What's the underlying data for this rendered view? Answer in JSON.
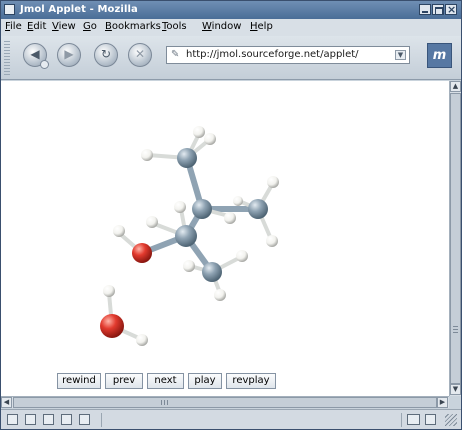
{
  "window": {
    "title": "Jmol Applet - Mozilla"
  },
  "menubar": {
    "items": [
      "File",
      "Edit",
      "View",
      "Go",
      "Bookmarks",
      "Tools",
      "Window",
      "Help"
    ],
    "mnemonics": [
      "F",
      "E",
      "V",
      "G",
      "B",
      "T",
      "W",
      "H"
    ]
  },
  "navigation": {
    "back_icon": "back-arrow-icon",
    "forward_icon": "forward-arrow-icon",
    "reload_icon": "reload-icon",
    "stop_icon": "stop-icon",
    "url": "http://jmol.sourceforge.net/applet/",
    "page_icon": "page-icon",
    "throbber_icon": "mozilla-logo-icon"
  },
  "applet": {
    "buttons": [
      "rewind",
      "prev",
      "next",
      "play",
      "revplay"
    ],
    "colors": {
      "carbon": "#8fa3b3",
      "oxygen": "#e23a2e",
      "hydrogen": "#f2f2ee",
      "bond": "#8fa3b3"
    }
  },
  "statusbar": {
    "icons": [
      "navigator-icon",
      "mail-icon",
      "composer-icon",
      "address-book-icon",
      "irc-icon",
      "online-icon",
      "security-icon"
    ]
  }
}
